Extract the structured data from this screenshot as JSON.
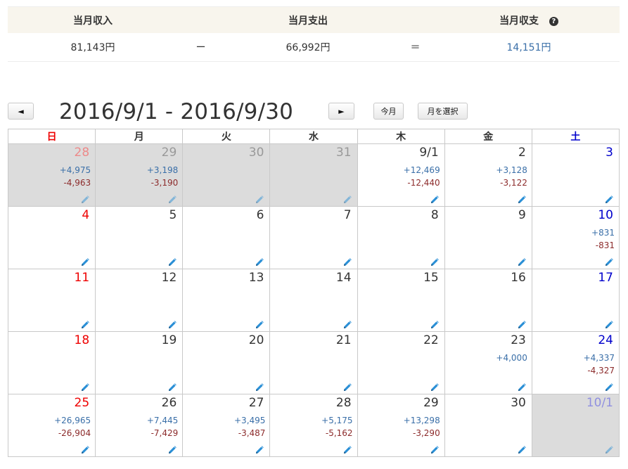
{
  "summary": {
    "income_label": "当月収入",
    "expense_label": "当月支出",
    "balance_label": "当月収支",
    "help_glyph": "?",
    "income_value": "81,143円",
    "minus_sign": "ー",
    "expense_value": "66,992円",
    "equals_sign": "＝",
    "balance_value": "14,151円"
  },
  "nav": {
    "prev_label": "◄",
    "next_label": "►",
    "range_title": "2016/9/1 - 2016/9/30",
    "today_label": "今月",
    "select_month_label": "月を選択"
  },
  "colors": {
    "income": "#3a6fa8",
    "expense": "#8c2b2b",
    "sunday": "#e00000",
    "saturday": "#0000cc",
    "edit_icon": "#2a8fd6",
    "other_month_bg": "#dcdcdc"
  },
  "weekdays": [
    "日",
    "月",
    "火",
    "水",
    "木",
    "金",
    "土"
  ],
  "weeks": [
    [
      {
        "day": "28",
        "income": "+4,975",
        "expense": "-4,963",
        "other": true
      },
      {
        "day": "29",
        "income": "+3,198",
        "expense": "-3,190",
        "other": true
      },
      {
        "day": "30",
        "income": "",
        "expense": "",
        "other": true
      },
      {
        "day": "31",
        "income": "",
        "expense": "",
        "other": true
      },
      {
        "day": "9/1",
        "income": "+12,469",
        "expense": "-12,440",
        "other": false
      },
      {
        "day": "2",
        "income": "+3,128",
        "expense": "-3,122",
        "other": false
      },
      {
        "day": "3",
        "income": "",
        "expense": "",
        "other": false
      }
    ],
    [
      {
        "day": "4",
        "income": "",
        "expense": "",
        "other": false
      },
      {
        "day": "5",
        "income": "",
        "expense": "",
        "other": false
      },
      {
        "day": "6",
        "income": "",
        "expense": "",
        "other": false
      },
      {
        "day": "7",
        "income": "",
        "expense": "",
        "other": false
      },
      {
        "day": "8",
        "income": "",
        "expense": "",
        "other": false
      },
      {
        "day": "9",
        "income": "",
        "expense": "",
        "other": false
      },
      {
        "day": "10",
        "income": "+831",
        "expense": "-831",
        "other": false
      }
    ],
    [
      {
        "day": "11",
        "income": "",
        "expense": "",
        "other": false
      },
      {
        "day": "12",
        "income": "",
        "expense": "",
        "other": false
      },
      {
        "day": "13",
        "income": "",
        "expense": "",
        "other": false
      },
      {
        "day": "14",
        "income": "",
        "expense": "",
        "other": false
      },
      {
        "day": "15",
        "income": "",
        "expense": "",
        "other": false
      },
      {
        "day": "16",
        "income": "",
        "expense": "",
        "other": false
      },
      {
        "day": "17",
        "income": "",
        "expense": "",
        "other": false
      }
    ],
    [
      {
        "day": "18",
        "income": "",
        "expense": "",
        "other": false
      },
      {
        "day": "19",
        "income": "",
        "expense": "",
        "other": false
      },
      {
        "day": "20",
        "income": "",
        "expense": "",
        "other": false
      },
      {
        "day": "21",
        "income": "",
        "expense": "",
        "other": false
      },
      {
        "day": "22",
        "income": "",
        "expense": "",
        "other": false
      },
      {
        "day": "23",
        "income": "+4,000",
        "expense": "",
        "other": false
      },
      {
        "day": "24",
        "income": "+4,337",
        "expense": "-4,327",
        "other": false
      }
    ],
    [
      {
        "day": "25",
        "income": "+26,965",
        "expense": "-26,904",
        "other": false
      },
      {
        "day": "26",
        "income": "+7,445",
        "expense": "-7,429",
        "other": false
      },
      {
        "day": "27",
        "income": "+3,495",
        "expense": "-3,487",
        "other": false
      },
      {
        "day": "28",
        "income": "+5,175",
        "expense": "-5,162",
        "other": false
      },
      {
        "day": "29",
        "income": "+13,298",
        "expense": "-3,290",
        "other": false
      },
      {
        "day": "30",
        "income": "",
        "expense": "",
        "other": false
      },
      {
        "day": "10/1",
        "income": "",
        "expense": "",
        "other": true
      }
    ]
  ]
}
